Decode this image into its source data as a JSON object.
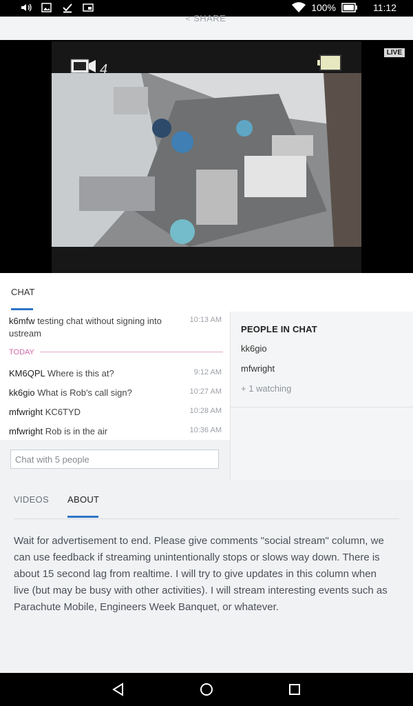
{
  "status_bar": {
    "battery": "100%",
    "time": "11:12"
  },
  "share_label": "SHARE",
  "video": {
    "live_badge": "LIVE",
    "camera_label": "4"
  },
  "chat_tab": "CHAT",
  "chat": {
    "messages": [
      {
        "user": "k6mfw",
        "text": "testing chat without signing into ustream",
        "time": "10:13 AM"
      },
      {
        "user": "KM6QPL",
        "text": "Where is this at?",
        "time": "9:12 AM"
      },
      {
        "user": "kk6gio",
        "text": "What is Rob's call sign?",
        "time": "10:27 AM"
      },
      {
        "user": "mfwright",
        "text": "KC6TYD",
        "time": "10:28 AM"
      },
      {
        "user": "mfwright",
        "text": "Rob is in the air",
        "time": "10:36 AM"
      }
    ],
    "divider": "TODAY",
    "input_placeholder": "Chat with 5 people"
  },
  "people": {
    "title": "PEOPLE IN CHAT",
    "names": [
      "kk6gio",
      "mfwright"
    ],
    "watching": "+ 1 watching"
  },
  "bottom_tabs": {
    "videos": "VIDEOS",
    "about": "ABOUT"
  },
  "about_text": "Wait for advertisement to end. Please give comments \"social stream\" column, we can use feedback if streaming unintentionally stops or slows way down. There is about 15 second lag from realtime. I will try to give updates in this column when live (but may be busy with other activities). I will stream interesting events such as Parachute Mobile, Engineers Week Banquet, or whatever.",
  "colors": {
    "accent": "#2e75c8",
    "today_divider": "#d26aa8"
  }
}
